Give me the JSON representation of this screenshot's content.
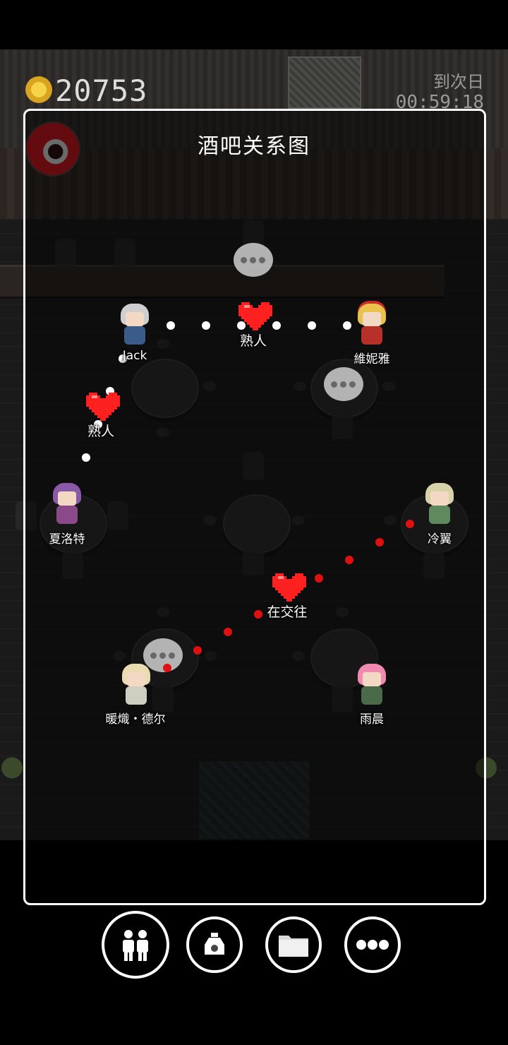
{
  "hud": {
    "gold": "20753",
    "next_day_label": "到次日",
    "timer": "00:59:18"
  },
  "panel": {
    "title": "酒吧关系图"
  },
  "characters": {
    "jack": "Jack",
    "vinia": "維妮雅",
    "charlotte": "夏洛特",
    "lengyi": "冷翼",
    "xuanweide": "暖熾・德尔",
    "yuchen": "雨晨"
  },
  "relations": {
    "jack_vinia": "熟人",
    "jack_charlotte": "熟人",
    "lengyi_xuanweide": "在交往"
  },
  "colors": {
    "acquaintance_line": "#ffffff",
    "dating_line": "#e01010",
    "heart": "#ff2020"
  },
  "nav": {
    "icons": [
      "people-icon",
      "bottle-icon",
      "folder-icon",
      "more-icon"
    ],
    "selected": "people-icon"
  }
}
